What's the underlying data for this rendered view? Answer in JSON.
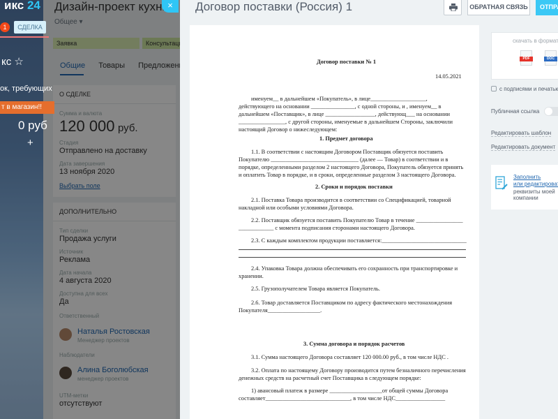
{
  "portal": {
    "logo_text": "икс",
    "logo_num": "24",
    "notif_count": "1",
    "done_label": "СДЕЛКА",
    "title": "кс ☆",
    "subtitle": "ок, требующих",
    "cart_label": "т в магазин!!",
    "sum": "0 руб",
    "plus": "+"
  },
  "deal": {
    "title": "Дизайн-проект кухни",
    "category": "Общее",
    "stages": [
      "Заявка",
      "Консультация"
    ],
    "tabs": [
      "Общие",
      "Товары",
      "Предложения"
    ],
    "about": {
      "header": "О СДЕЛКЕ",
      "sum_label": "Сумма и валюта",
      "sum_value": "120 000",
      "currency": "руб.",
      "stage_label": "Стадия",
      "stage_value": "Отправлено на доставку",
      "close_label": "Дата завершения",
      "close_value": "13 ноября 2020",
      "choose_field": "Выбрать поле"
    },
    "extra": {
      "header": "ДОПОЛНИТЕЛЬНО",
      "type_label": "Тип сделки",
      "type_value": "Продажа услуги",
      "source_label": "Источник",
      "source_value": "Реклама",
      "start_label": "Дата начала",
      "start_value": "4 августа 2020",
      "access_label": "Доступна для всех",
      "access_value": "Да",
      "responsible_label": "Ответственный",
      "responsible_name": "Наталья Ростовская",
      "responsible_role": "Менеджер проектов",
      "observers_label": "Наблюдатели",
      "observer_name": "Алина Боголюбская",
      "observer_role": "менеджер проектов",
      "utm_label": "UTM-метки",
      "utm_value": "отсутствуют"
    }
  },
  "slider": {
    "close": "×",
    "title": "Договор поставки (Россия) 1",
    "feedback": "ОБРАТНАЯ СВЯЗЬ",
    "send": "ОТПРАВИТЬ"
  },
  "document": {
    "title": "Договор поставки № 1",
    "date": "14.05.2021",
    "p0": [
      "именуем__ в дальнейшем «Покупатель», в лице___________________,",
      "действующего на основании _______________, с одной стороны, и , именуем__ в",
      "дальнейшем «Поставщик», в лице _________________, действующ___ на основании",
      "________________, с другой стороны, именуемые в дальнейшем Стороны, заключили",
      "настоящий Договор о нижеследующем:"
    ],
    "s1": "1. Предмет договора",
    "p11": [
      "1.1. В соответствии с настоящим Договором Поставщик обязуется поставить",
      "Покупателю ______________________________ (далее — Товар) в соответствии и в",
      "порядке, определенными разделом 2 настоящего Договора, Покупатель обязуется принять",
      "и оплатить Товар в порядке, и в сроки, определенные разделом 3 настоящего Договора."
    ],
    "s2": "2. Сроки и порядок поставки",
    "p21": [
      "2.1. Поставка Товара производится в соответствии со Спецификацией, товарной",
      "накладной или особыми условиями Договора."
    ],
    "p22": [
      "2.2. Поставщик обязуется поставить Покупателю Товар в течение ________________",
      "____________ с момента подписания сторонами настоящего Договора."
    ],
    "p23": "2.3. С каждым комплектом продукции поставляется:_____________________________",
    "p24": [
      "2.4. Упаковка Товара должна обеспечивать его сохранность при транспортировке и",
      "хранении."
    ],
    "p25": "2.5. Грузополучателем Товара является Покупатель.",
    "p26": [
      "2.6. Товар доставляется Поставщиком по адресу фактического местонахождения",
      "Покупателя__________________."
    ],
    "s3": "3. Сумма договора и порядок расчетов",
    "p31": "3.1. Сумма настоящего Договора составляет 120 000.00 руб., в том числе НДС .",
    "p32": [
      "3.2. Оплата по настоящему Договору производится путем безналичного перечисления",
      "денежных средств на расчетный счет Поставщика в следующем порядке:"
    ],
    "p33": [
      "1) авансовый платеж в размере __________________от общей суммы Договора",
      "составляет_____________________________, в том числе НДС_________________"
    ]
  },
  "sidebar": {
    "download_caption": "скачать в формате:",
    "pdf": "PDF",
    "docx": "DOC",
    "sign_label": "с подписями и печатью",
    "public_link": "Публичная ссылка",
    "edit_template": "Редактировать шаблон",
    "edit_document": "Редактировать документ",
    "fill_link_1": "Заполнить",
    "fill_link_2": "или редактировать",
    "fill_text_1": "реквизиты моей",
    "fill_text_2": "компании"
  }
}
